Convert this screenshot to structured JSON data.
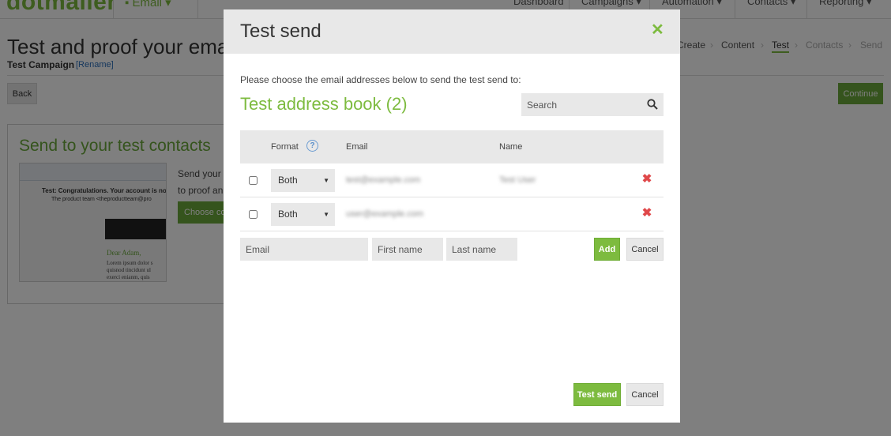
{
  "app": {
    "logo": "dotmailer",
    "email_menu": "Email",
    "nav": [
      "Dashboard",
      "Campaigns",
      "Automation",
      "Contacts",
      "Reporting"
    ]
  },
  "page": {
    "title": "Test and proof your email",
    "campaign_name": "Test Campaign",
    "rename_link": "[Rename]",
    "back_label": "Back",
    "continue_label": "Continue",
    "breadcrumb": [
      {
        "label": "Create",
        "state": "done"
      },
      {
        "label": "Content",
        "state": "done"
      },
      {
        "label": "Test",
        "state": "active"
      },
      {
        "label": "Contacts",
        "state": "todo"
      },
      {
        "label": "Send",
        "state": "todo"
      }
    ],
    "panel": {
      "title": "Send to your test contacts",
      "text_line1": "Send your",
      "text_line2": "to proof an",
      "choose_button": "Choose co",
      "thumb_subject": "Test: Congratulations. Your account is now",
      "thumb_from": "The product team <theproductteam@pro",
      "thumb_greeting": "Dear Adam,",
      "thumb_body_1": "Lorem ipsum dolor s",
      "thumb_body_2": "quisnod tincidunt ul",
      "thumb_body_3": "exerci enianm, quis"
    }
  },
  "modal": {
    "title": "Test send",
    "intro": "Please choose the email addresses below to send the test send to:",
    "book_title": "Test address book (2)",
    "search_placeholder": "Search",
    "columns": {
      "format": "Format",
      "email": "Email",
      "name": "Name"
    },
    "help_glyph": "?",
    "rows": [
      {
        "format": "Both",
        "email": "test@example.com",
        "name": "Test User"
      },
      {
        "format": "Both",
        "email": "user@example.com",
        "name": ""
      }
    ],
    "new_contact": {
      "email_placeholder": "Email",
      "first_name_placeholder": "First name",
      "last_name_placeholder": "Last name",
      "add_label": "Add",
      "cancel_label": "Cancel"
    },
    "footer": {
      "test_send_label": "Test send",
      "cancel_label": "Cancel"
    }
  },
  "colors": {
    "brand_green": "#7dbb3f",
    "dark_green": "#6aa83b",
    "delete_red": "#e0484a",
    "help_blue": "#5a8fca"
  }
}
